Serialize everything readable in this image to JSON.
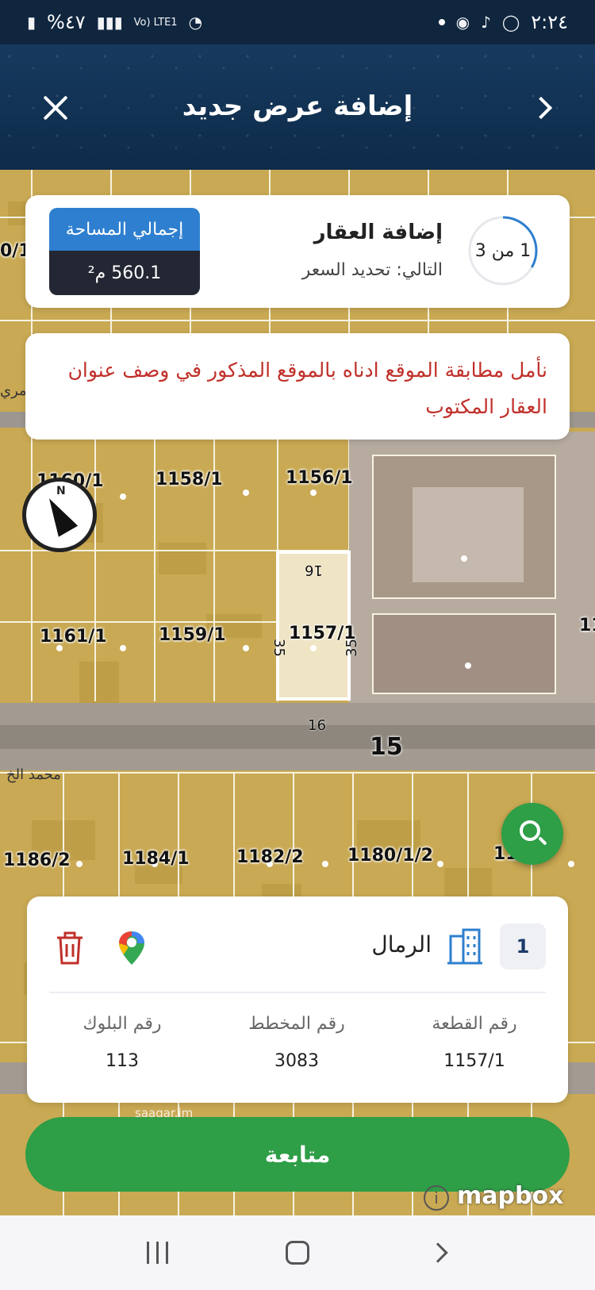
{
  "status_bar": {
    "time": "٢:٢٤",
    "battery": "%٤٧",
    "network": "Vo) LTE1"
  },
  "header": {
    "title": "إضافة عرض جديد"
  },
  "step_card": {
    "progress_text": "1 من 3",
    "progress_fraction": 0.333,
    "title": "إضافة العقار",
    "next": "التالي: تحديد السعر",
    "area_label": "إجمالي المساحة",
    "area_value": "560.1 م²"
  },
  "notice": {
    "text": "نأمل مطابقة الموقع ادناه بالموقع المذكور في وصف عنوان العقار المكتوب"
  },
  "map": {
    "plots": [
      "1160/1",
      "1158/1",
      "1156/1",
      "1161/1",
      "1159/1",
      "1157/1",
      "1186/2",
      "1184/1",
      "1182/2",
      "1180/1/2",
      "11",
      "11"
    ],
    "dims": [
      "16",
      "35",
      "35",
      "16"
    ],
    "street_width": "15",
    "street_name": "محمد الخ",
    "left_clip": "0/1",
    "street_clip": "مري",
    "watermark": "saaqar.im",
    "attribution": "mapbox",
    "info_symbol": "i"
  },
  "info_card": {
    "index": "1",
    "district": "الرمال",
    "columns": [
      {
        "label": "رقم القطعة",
        "value": "1157/1"
      },
      {
        "label": "رقم المخطط",
        "value": "3083"
      },
      {
        "label": "رقم البلوك",
        "value": "113"
      }
    ]
  },
  "continue_label": "متابعة",
  "colors": {
    "header": "#0e2b4a",
    "accent_green": "#2e9e47",
    "accent_blue": "#2e7fcf",
    "notice_red": "#c0302a",
    "parcel_yellow": "#c6a64f"
  }
}
